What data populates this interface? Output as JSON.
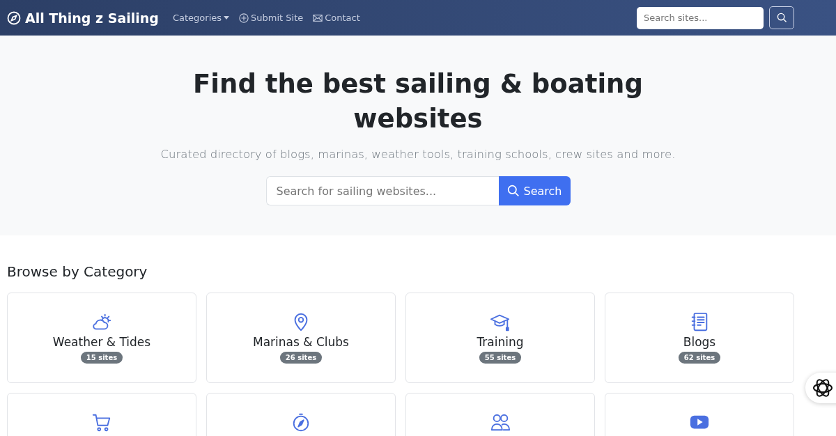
{
  "navbar": {
    "brand": "All Thing z Sailing",
    "links": [
      {
        "kind": "dropdown",
        "label": "Categories"
      },
      {
        "kind": "submit",
        "label": "Submit Site"
      },
      {
        "kind": "contact",
        "label": "Contact"
      }
    ],
    "search": {
      "placeholder": "Search sites..."
    }
  },
  "hero": {
    "title": "Find the best sailing & boating websites",
    "subtitle": "Curated directory of blogs, marinas, weather tools, training schools, crew sites and more.",
    "search": {
      "placeholder": "Search for sailing websites...",
      "button": "Search"
    }
  },
  "categories": {
    "heading": "Browse by Category",
    "cards": [
      {
        "kind": "weather",
        "title": "Weather & Tides",
        "count": "15 sites"
      },
      {
        "kind": "pin",
        "title": "Marinas & Clubs",
        "count": "26 sites"
      },
      {
        "kind": "cap",
        "title": "Training",
        "count": "55 sites"
      },
      {
        "kind": "journal",
        "title": "Blogs",
        "count": "62 sites"
      },
      {
        "kind": "cart"
      },
      {
        "kind": "compass"
      },
      {
        "kind": "people"
      },
      {
        "kind": "video"
      }
    ]
  }
}
